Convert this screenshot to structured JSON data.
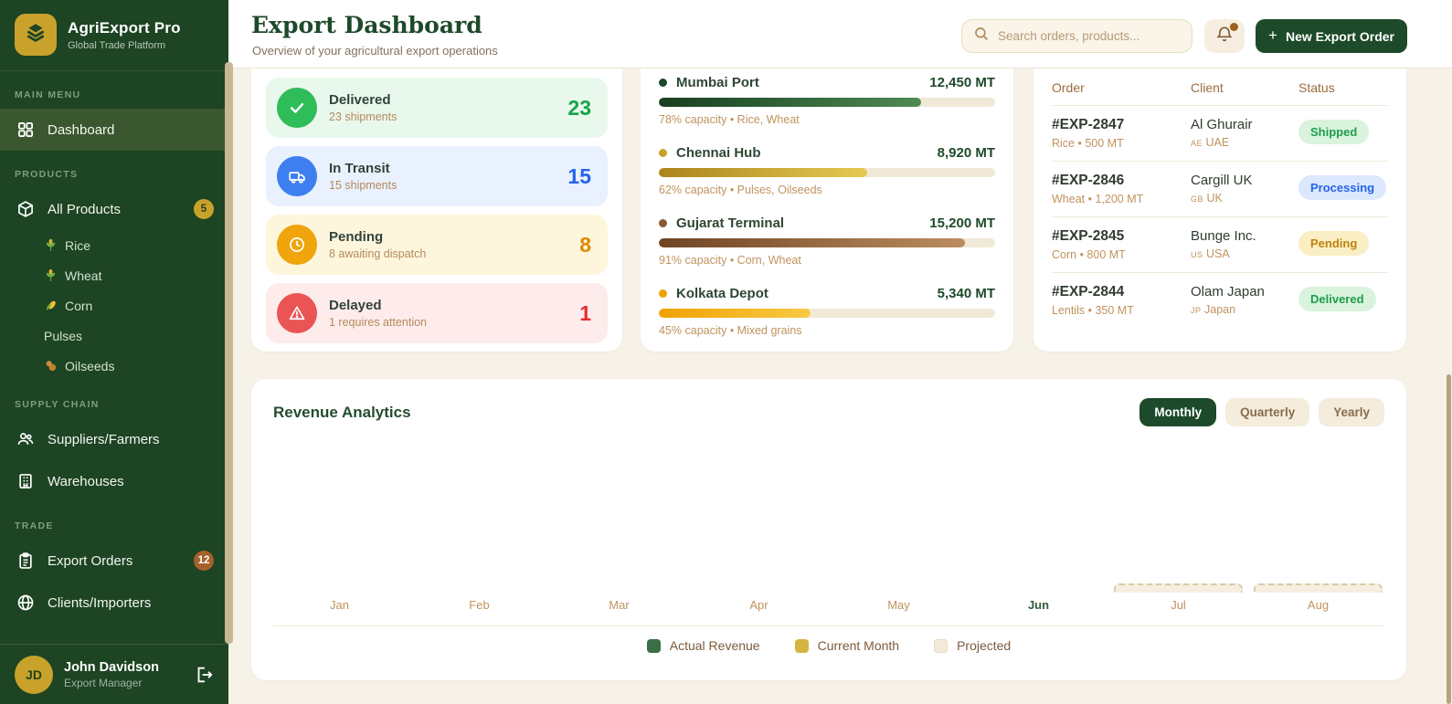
{
  "brand": {
    "name": "AgriExport Pro",
    "tagline": "Global Trade Platform",
    "logo_bg": "#c9a22b",
    "sidebar_bg": "#1d4423",
    "accent_green": "#1d4a2a"
  },
  "sidebar": {
    "section_main": "MAIN MENU",
    "dashboard": "Dashboard",
    "section_products": "PRODUCTS",
    "all_products": "All Products",
    "all_products_badge": "5",
    "products": [
      {
        "label": "Rice",
        "icon": "wheat-sprig-icon"
      },
      {
        "label": "Wheat",
        "icon": "wheat-sprig-icon"
      },
      {
        "label": "Corn",
        "icon": "corn-icon"
      },
      {
        "label": "Pulses",
        "icon": null
      },
      {
        "label": "Oilseeds",
        "icon": "peanut-icon"
      }
    ],
    "section_supply": "SUPPLY CHAIN",
    "suppliers": "Suppliers/Farmers",
    "warehouses_item": "Warehouses",
    "section_trade": "TRADE",
    "export_orders": "Export Orders",
    "export_orders_badge": "12",
    "clients": "Clients/Importers",
    "user": {
      "initials": "JD",
      "name": "John Davidson",
      "role": "Export Manager"
    }
  },
  "header": {
    "title": "Export Dashboard",
    "subtitle": "Overview of your agricultural export operations",
    "search_placeholder": "Search orders, products...",
    "plus": "+",
    "new_order_label": "New Export Order"
  },
  "status_cards": [
    {
      "title": "Delivered",
      "subtitle": "23 shipments",
      "count": "23",
      "icon": "check-icon",
      "tile_bg": "#e9f8ec",
      "icon_bg": "#2ebd59",
      "count_color": "#17a34a"
    },
    {
      "title": "In Transit",
      "subtitle": "15 shipments",
      "count": "15",
      "icon": "truck-icon",
      "tile_bg": "#e8f1fd",
      "icon_bg": "#3d7ef0",
      "count_color": "#2563eb"
    },
    {
      "title": "Pending",
      "subtitle": "8 awaiting dispatch",
      "count": "8",
      "icon": "clock-icon",
      "tile_bg": "#fdf6dd",
      "icon_bg": "#efa50b",
      "count_color": "#df8a00"
    },
    {
      "title": "Delayed",
      "subtitle": "1 requires attention",
      "count": "1",
      "icon": "alert-icon",
      "tile_bg": "#fdeceb",
      "icon_bg": "#ea5455",
      "count_color": "#e02d2d"
    }
  ],
  "warehouses": [
    {
      "name": "Mumbai Port",
      "value": "12,450 MT",
      "capacity_pct": 78,
      "caption": "78% capacity • Rice, Wheat",
      "color": "#1d4a2a"
    },
    {
      "name": "Chennai Hub",
      "value": "8,920 MT",
      "capacity_pct": 62,
      "caption": "62% capacity • Pulses, Oilseeds",
      "color": "#c9a22b"
    },
    {
      "name": "Gujarat Terminal",
      "value": "15,200 MT",
      "capacity_pct": 91,
      "caption": "91% capacity • Corn, Wheat",
      "color": "#8a5a33"
    },
    {
      "name": "Kolkata Depot",
      "value": "5,340 MT",
      "capacity_pct": 45,
      "caption": "45% capacity • Mixed grains",
      "color": "#f0a202"
    }
  ],
  "orders": {
    "headers": [
      "Order",
      "Client",
      "Status"
    ],
    "rows": [
      {
        "id": "#EXP-2847",
        "detail": "Rice • 500 MT",
        "client": "Al Ghurair",
        "country_code": "AE",
        "country": "UAE",
        "status": "Shipped",
        "status_bg": "#d9f3dd",
        "status_color": "#1f9d4d"
      },
      {
        "id": "#EXP-2846",
        "detail": "Wheat • 1,200 MT",
        "client": "Cargill UK",
        "country_code": "GB",
        "country": "UK",
        "status": "Processing",
        "status_bg": "#dce8fd",
        "status_color": "#2563eb"
      },
      {
        "id": "#EXP-2845",
        "detail": "Corn • 800 MT",
        "client": "Bunge Inc.",
        "country_code": "US",
        "country": "USA",
        "status": "Pending",
        "status_bg": "#faeec4",
        "status_color": "#c0820e"
      },
      {
        "id": "#EXP-2844",
        "detail": "Lentils • 350 MT",
        "client": "Olam Japan",
        "country_code": "JP",
        "country": "Japan",
        "status": "Delivered",
        "status_bg": "#d9f3dd",
        "status_color": "#1f9d4d"
      }
    ]
  },
  "revenue": {
    "title": "Revenue Analytics",
    "tabs": [
      {
        "label": "Monthly",
        "active": true
      },
      {
        "label": "Quarterly",
        "active": false
      },
      {
        "label": "Yearly",
        "active": false
      }
    ]
  },
  "chart_data": {
    "type": "bar",
    "title": "Revenue Analytics",
    "categories": [
      "Jan",
      "Feb",
      "Mar",
      "Apr",
      "May",
      "Jun",
      "Jul",
      "Aug"
    ],
    "series": [
      {
        "name": "Actual Revenue",
        "color": "#3b6e45",
        "values": [
          0,
          0,
          0,
          0,
          0,
          null,
          null,
          null
        ]
      },
      {
        "name": "Current Month",
        "color": "#d4b542",
        "values": [
          null,
          null,
          null,
          null,
          null,
          0,
          null,
          null
        ]
      },
      {
        "name": "Projected",
        "color": "#f3ead9",
        "values": [
          null,
          null,
          null,
          null,
          null,
          null,
          8,
          8
        ]
      }
    ],
    "highlighted_category": "Jun",
    "projected_categories": [
      "Jul",
      "Aug"
    ],
    "legend": [
      "Actual Revenue",
      "Current Month",
      "Projected"
    ],
    "legend_position": "bottom",
    "grid": false,
    "note": "Bars for Jan–Jun render at near-zero height; Jul and Aug show short dashed projected placeholder bars at the baseline."
  }
}
